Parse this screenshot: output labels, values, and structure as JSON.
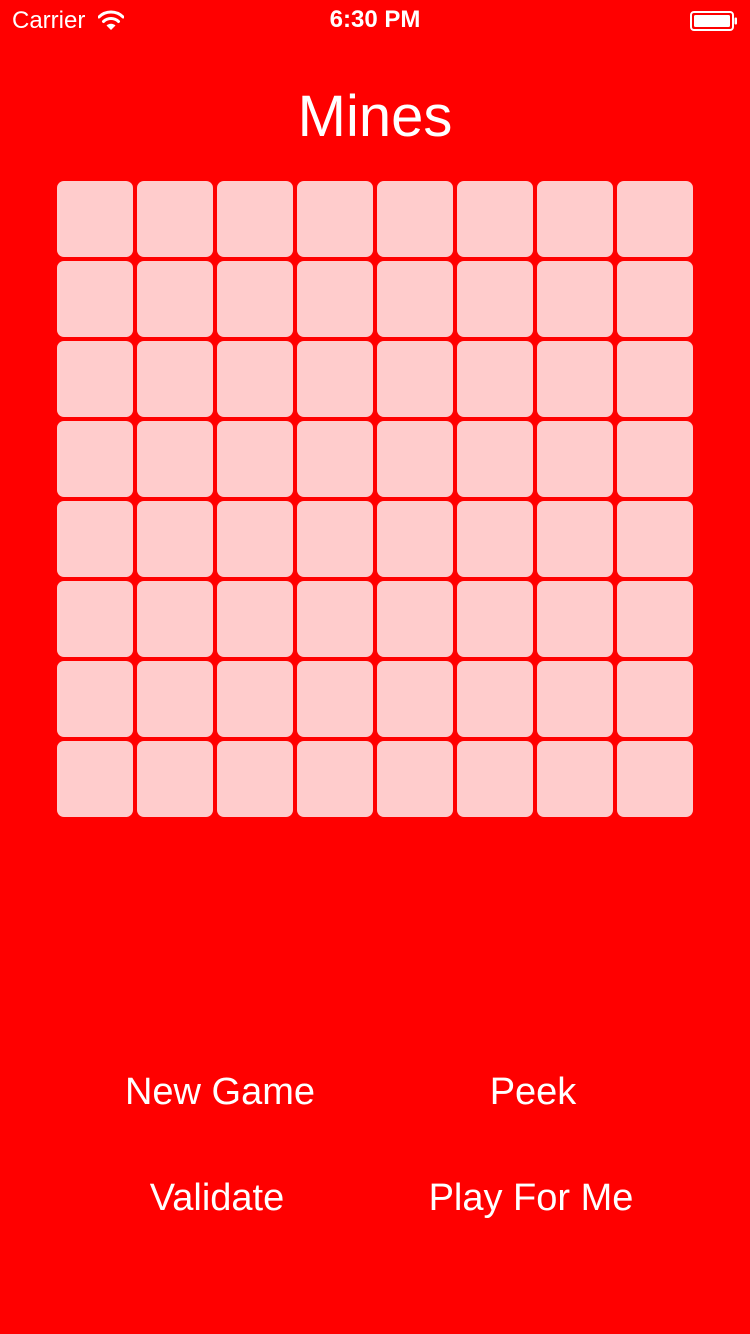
{
  "status_bar": {
    "carrier": "Carrier",
    "time": "6:30 PM",
    "wifi_icon": "wifi-icon",
    "battery_icon": "battery-icon"
  },
  "title": "Mines",
  "board": {
    "rows": 8,
    "columns": 8,
    "cell_state": "covered"
  },
  "buttons": {
    "new_game": "New Game",
    "peek": "Peek",
    "validate": "Validate",
    "play_for_me": "Play For Me"
  },
  "colors": {
    "background": "#FF0000",
    "cell": "#FFCCCC",
    "text": "#FFFFFF"
  }
}
